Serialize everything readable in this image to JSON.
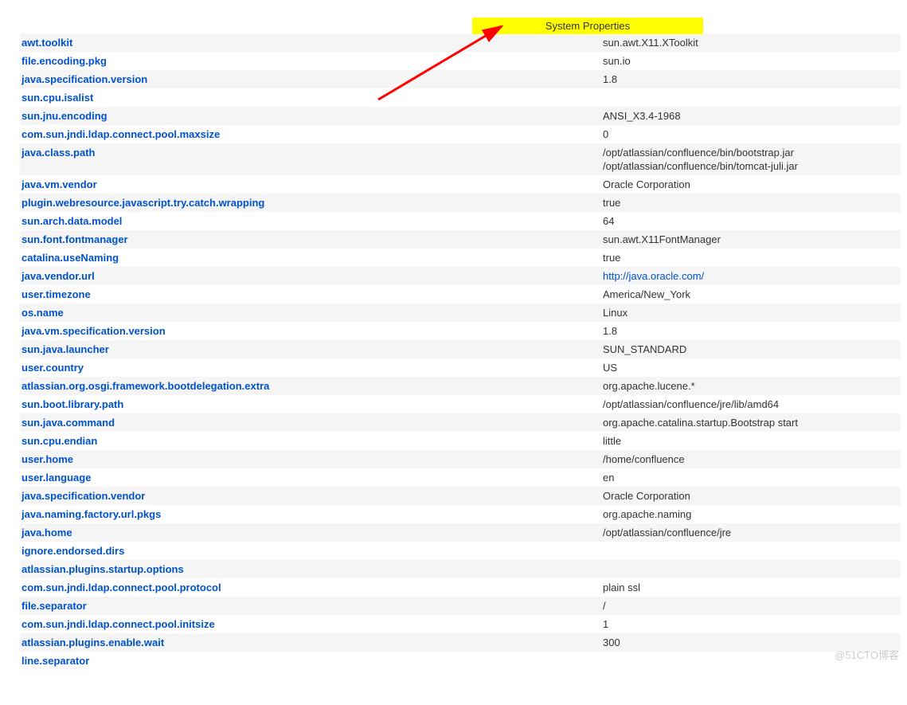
{
  "header": {
    "title": "System Properties"
  },
  "watermark": "@51CTO博客",
  "rows": [
    {
      "key": "awt.toolkit",
      "val": "sun.awt.X11.XToolkit"
    },
    {
      "key": "file.encoding.pkg",
      "val": "sun.io"
    },
    {
      "key": "java.specification.version",
      "val": "1.8"
    },
    {
      "key": "sun.cpu.isalist",
      "val": ""
    },
    {
      "key": "sun.jnu.encoding",
      "val": "ANSI_X3.4-1968"
    },
    {
      "key": "com.sun.jndi.ldap.connect.pool.maxsize",
      "val": "0"
    },
    {
      "key": "java.class.path",
      "val": "/opt/atlassian/confluence/bin/bootstrap.jar\n/opt/atlassian/confluence/bin/tomcat-juli.jar"
    },
    {
      "key": "java.vm.vendor",
      "val": "Oracle Corporation"
    },
    {
      "key": "plugin.webresource.javascript.try.catch.wrapping",
      "val": "true"
    },
    {
      "key": "sun.arch.data.model",
      "val": "64"
    },
    {
      "key": "sun.font.fontmanager",
      "val": "sun.awt.X11FontManager"
    },
    {
      "key": "catalina.useNaming",
      "val": "true"
    },
    {
      "key": "java.vendor.url",
      "val": "http://java.oracle.com/",
      "link": true
    },
    {
      "key": "user.timezone",
      "val": "America/New_York"
    },
    {
      "key": "os.name",
      "val": "Linux"
    },
    {
      "key": "java.vm.specification.version",
      "val": "1.8"
    },
    {
      "key": "sun.java.launcher",
      "val": "SUN_STANDARD"
    },
    {
      "key": "user.country",
      "val": "US"
    },
    {
      "key": "atlassian.org.osgi.framework.bootdelegation.extra",
      "val": "org.apache.lucene.*"
    },
    {
      "key": "sun.boot.library.path",
      "val": "/opt/atlassian/confluence/jre/lib/amd64"
    },
    {
      "key": "sun.java.command",
      "val": "org.apache.catalina.startup.Bootstrap start"
    },
    {
      "key": "sun.cpu.endian",
      "val": "little"
    },
    {
      "key": "user.home",
      "val": "/home/confluence"
    },
    {
      "key": "user.language",
      "val": "en"
    },
    {
      "key": "java.specification.vendor",
      "val": "Oracle Corporation"
    },
    {
      "key": "java.naming.factory.url.pkgs",
      "val": "org.apache.naming"
    },
    {
      "key": "java.home",
      "val": "/opt/atlassian/confluence/jre"
    },
    {
      "key": "ignore.endorsed.dirs",
      "val": ""
    },
    {
      "key": "atlassian.plugins.startup.options",
      "val": ""
    },
    {
      "key": "com.sun.jndi.ldap.connect.pool.protocol",
      "val": "plain ssl"
    },
    {
      "key": "file.separator",
      "val": "/"
    },
    {
      "key": "com.sun.jndi.ldap.connect.pool.initsize",
      "val": "1"
    },
    {
      "key": "atlassian.plugins.enable.wait",
      "val": "300"
    },
    {
      "key": "line.separator",
      "val": ""
    }
  ]
}
